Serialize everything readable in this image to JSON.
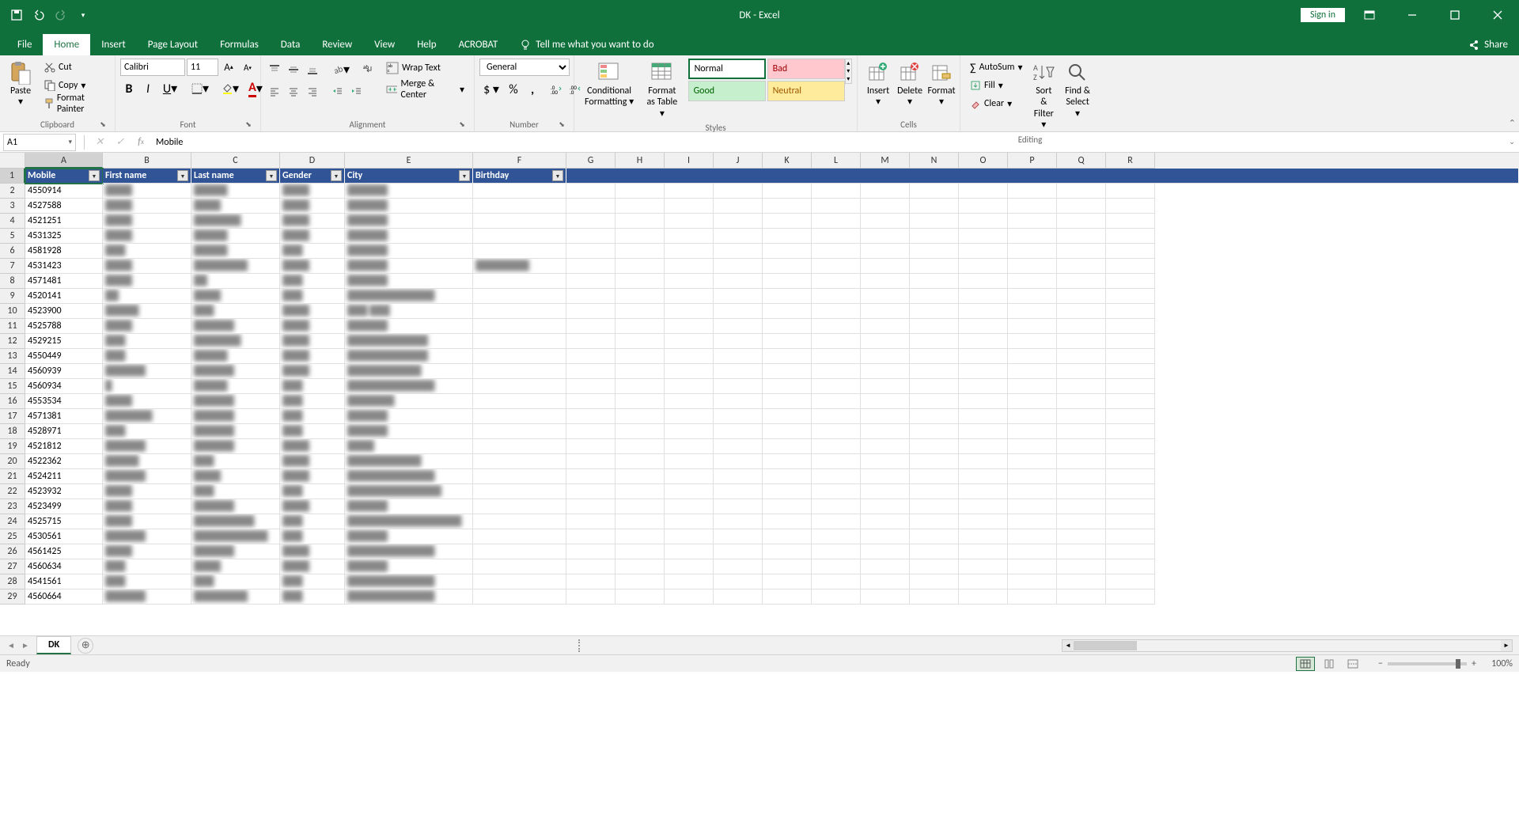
{
  "app": {
    "title": "DK  -  Excel"
  },
  "titlebar": {
    "signin": "Sign in"
  },
  "tabs": {
    "file": "File",
    "home": "Home",
    "insert": "Insert",
    "pagelayout": "Page Layout",
    "formulas": "Formulas",
    "data": "Data",
    "review": "Review",
    "view": "View",
    "help": "Help",
    "acrobat": "ACROBAT",
    "tellme": "Tell me what you want to do",
    "share": "Share"
  },
  "ribbon": {
    "clipboard": {
      "paste": "Paste",
      "cut": "Cut",
      "copy": "Copy",
      "formatpainter": "Format Painter",
      "label": "Clipboard"
    },
    "font": {
      "name": "Calibri",
      "size": "11",
      "label": "Font"
    },
    "alignment": {
      "wraptext": "Wrap Text",
      "mergecenter": "Merge & Center",
      "label": "Alignment"
    },
    "number": {
      "format": "General",
      "label": "Number"
    },
    "styles": {
      "condfmt": "Conditional Formatting",
      "fmttable": "Format as Table",
      "normal": "Normal",
      "bad": "Bad",
      "good": "Good",
      "neutral": "Neutral",
      "label": "Styles"
    },
    "cells": {
      "insert": "Insert",
      "delete": "Delete",
      "format": "Format",
      "label": "Cells"
    },
    "editing": {
      "autosum": "AutoSum",
      "fill": "Fill",
      "clear": "Clear",
      "sortfilter": "Sort & Filter",
      "findselect": "Find & Select",
      "label": "Editing"
    }
  },
  "formulabar": {
    "namebox": "A1",
    "value": "Mobile"
  },
  "columns": {
    "letters": [
      "A",
      "B",
      "C",
      "D",
      "E",
      "F",
      "G",
      "H",
      "I",
      "J",
      "K",
      "L",
      "M",
      "N",
      "O",
      "P",
      "Q",
      "R"
    ],
    "widths": [
      98,
      112,
      112,
      82,
      162,
      118,
      62,
      62,
      62,
      62,
      62,
      62,
      62,
      62,
      62,
      62,
      62,
      62
    ]
  },
  "table": {
    "headers": [
      "Mobile",
      "First name",
      "Last name",
      "Gender",
      "City",
      "Birthday"
    ],
    "rows": [
      [
        "4550914",
        "████",
        "█████",
        "████",
        "██████",
        ""
      ],
      [
        "4527588",
        "████",
        "████",
        "████",
        "██████",
        ""
      ],
      [
        "4521251",
        "████",
        "███████",
        "████",
        "██████",
        ""
      ],
      [
        "4531325",
        "████",
        "█████",
        "████",
        "██████",
        ""
      ],
      [
        "4581928",
        "███",
        "█████",
        "███",
        "██████",
        ""
      ],
      [
        "4531423",
        "████",
        "████████",
        "████",
        "██████",
        "████████"
      ],
      [
        "4571481",
        "████",
        "██",
        "███",
        "██████",
        ""
      ],
      [
        "4520141",
        "██",
        "████",
        "███",
        "█████████████",
        ""
      ],
      [
        "4523900",
        "█████",
        "███",
        "████",
        "███ ███",
        ""
      ],
      [
        "4525788",
        "████",
        "██████",
        "████",
        "██████",
        ""
      ],
      [
        "4529215",
        "███",
        "███████",
        "████",
        "████████████",
        ""
      ],
      [
        "4550449",
        "███",
        "█████",
        "████",
        "████████████",
        ""
      ],
      [
        "4560939",
        "██████",
        "██████",
        "████",
        "███████████",
        ""
      ],
      [
        "4560934",
        "█",
        "█████",
        "███",
        "█████████████",
        ""
      ],
      [
        "4553534",
        "████",
        "██████",
        "███",
        "███████",
        ""
      ],
      [
        "4571381",
        "███████",
        "██████",
        "███",
        "██████",
        ""
      ],
      [
        "4528971",
        "███",
        "██████",
        "███",
        "██████",
        ""
      ],
      [
        "4521812",
        "██████",
        "██████",
        "████",
        "████",
        ""
      ],
      [
        "4522362",
        "█████",
        "███",
        "████",
        "███████████",
        ""
      ],
      [
        "4524211",
        "██████",
        "████",
        "████",
        "█████████████",
        ""
      ],
      [
        "4523932",
        "████",
        "███",
        "███",
        "██████████████",
        ""
      ],
      [
        "4523499",
        "████",
        "██████",
        "████",
        "██████",
        ""
      ],
      [
        "4525715",
        "████",
        "█████████",
        "███",
        "█████████████████",
        ""
      ],
      [
        "4530561",
        "██████",
        "███████████",
        "███",
        "██████",
        ""
      ],
      [
        "4561425",
        "████",
        "██████",
        "████",
        "█████████████",
        ""
      ],
      [
        "4560634",
        "███",
        "████",
        "████",
        "██████",
        ""
      ],
      [
        "4541561",
        "███",
        "███",
        "███",
        "█████████████",
        ""
      ],
      [
        "4560664",
        "██████",
        "████████",
        "███",
        "█████████████",
        ""
      ]
    ]
  },
  "sheets": {
    "active": "DK"
  },
  "statusbar": {
    "ready": "Ready",
    "zoom": "100%"
  }
}
